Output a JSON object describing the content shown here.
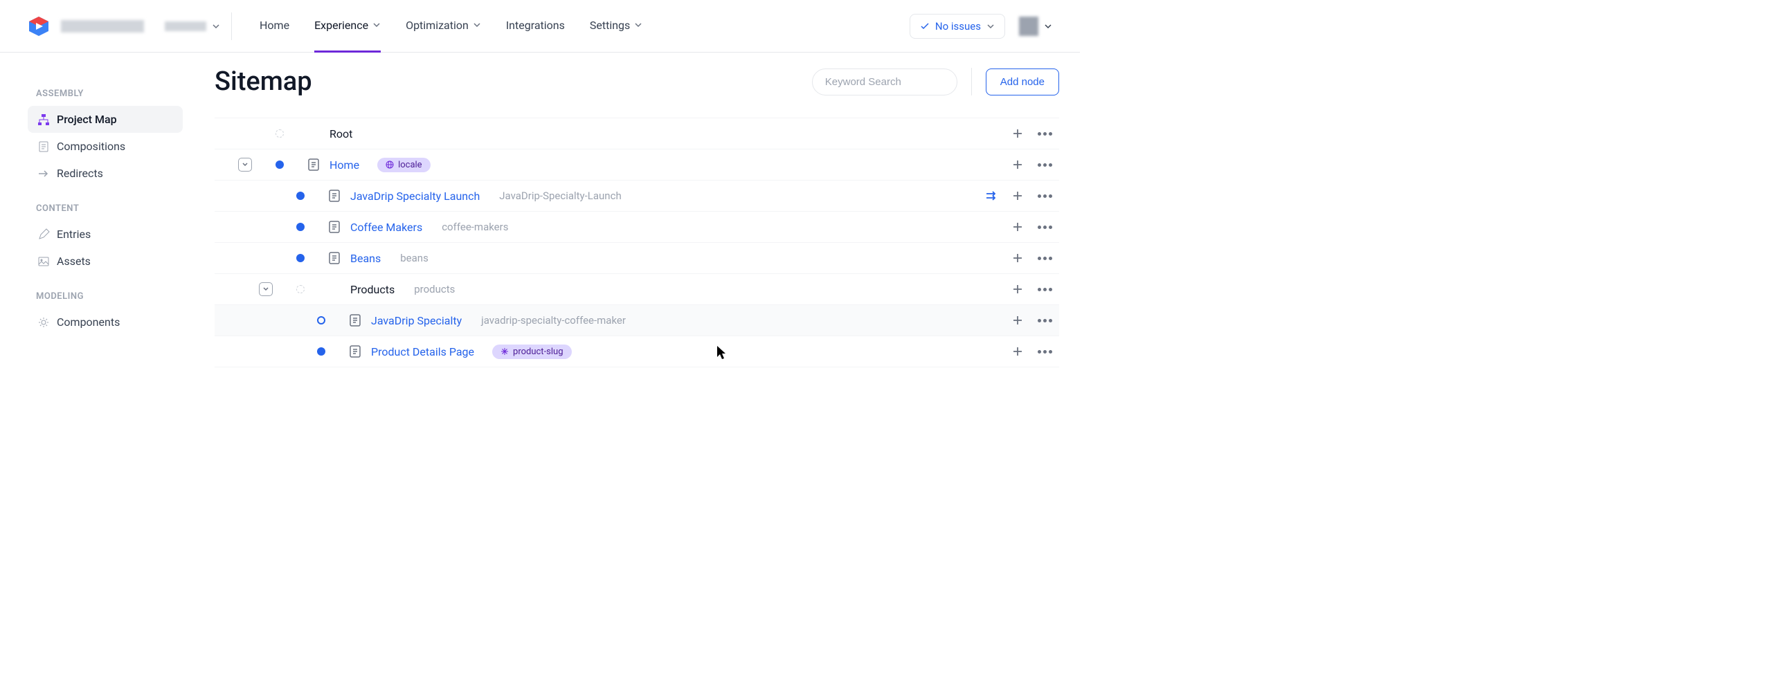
{
  "nav": {
    "tabs": [
      "Home",
      "Experience",
      "Optimization",
      "Integrations",
      "Settings"
    ],
    "active_index": 1,
    "issues_label": "No issues"
  },
  "sidebar": {
    "groups": [
      {
        "label": "ASSEMBLY",
        "items": [
          {
            "label": "Project Map",
            "icon": "sitemap",
            "active": true
          },
          {
            "label": "Compositions",
            "icon": "document",
            "active": false
          },
          {
            "label": "Redirects",
            "icon": "redirect",
            "active": false
          }
        ]
      },
      {
        "label": "CONTENT",
        "items": [
          {
            "label": "Entries",
            "icon": "pencil",
            "active": false
          },
          {
            "label": "Assets",
            "icon": "image",
            "active": false
          }
        ]
      },
      {
        "label": "MODELING",
        "items": [
          {
            "label": "Components",
            "icon": "gear",
            "active": false
          }
        ]
      }
    ]
  },
  "page": {
    "title": "Sitemap",
    "search_placeholder": "Keyword Search",
    "add_node_label": "Add node"
  },
  "tree": [
    {
      "indent": 0,
      "collapse": null,
      "status": "empty",
      "doc_icon": false,
      "label": "Root",
      "label_plain": true,
      "slug": null,
      "badge": null,
      "redirect": false,
      "hover": false
    },
    {
      "indent": 0,
      "collapse": "down",
      "status": "filled",
      "doc_icon": true,
      "label": "Home",
      "label_plain": false,
      "slug": null,
      "badge": {
        "icon": "globe",
        "text": "locale"
      },
      "redirect": false,
      "hover": false
    },
    {
      "indent": 1,
      "collapse": null,
      "status": "filled",
      "doc_icon": true,
      "label": "JavaDrip Specialty Launch",
      "label_plain": false,
      "slug": "JavaDrip-Specialty-Launch",
      "badge": null,
      "redirect": true,
      "hover": false
    },
    {
      "indent": 1,
      "collapse": null,
      "status": "filled",
      "doc_icon": true,
      "label": "Coffee Makers",
      "label_plain": false,
      "slug": "coffee-makers",
      "badge": null,
      "redirect": false,
      "hover": false
    },
    {
      "indent": 1,
      "collapse": null,
      "status": "filled",
      "doc_icon": true,
      "label": "Beans",
      "label_plain": false,
      "slug": "beans",
      "badge": null,
      "redirect": false,
      "hover": false
    },
    {
      "indent": 1,
      "collapse": "down",
      "status": "empty",
      "doc_icon": false,
      "label": "Products",
      "label_plain": true,
      "slug": "products",
      "badge": null,
      "redirect": false,
      "hover": false
    },
    {
      "indent": 2,
      "collapse": null,
      "status": "ring",
      "doc_icon": true,
      "label": "JavaDrip Specialty",
      "label_plain": false,
      "slug": "javadrip-specialty-coffee-maker",
      "badge": null,
      "redirect": false,
      "hover": true
    },
    {
      "indent": 2,
      "collapse": null,
      "status": "filled",
      "doc_icon": true,
      "label": "Product Details Page",
      "label_plain": false,
      "slug": null,
      "badge": {
        "icon": "asterisk",
        "text": "product-slug"
      },
      "redirect": false,
      "hover": false
    }
  ]
}
